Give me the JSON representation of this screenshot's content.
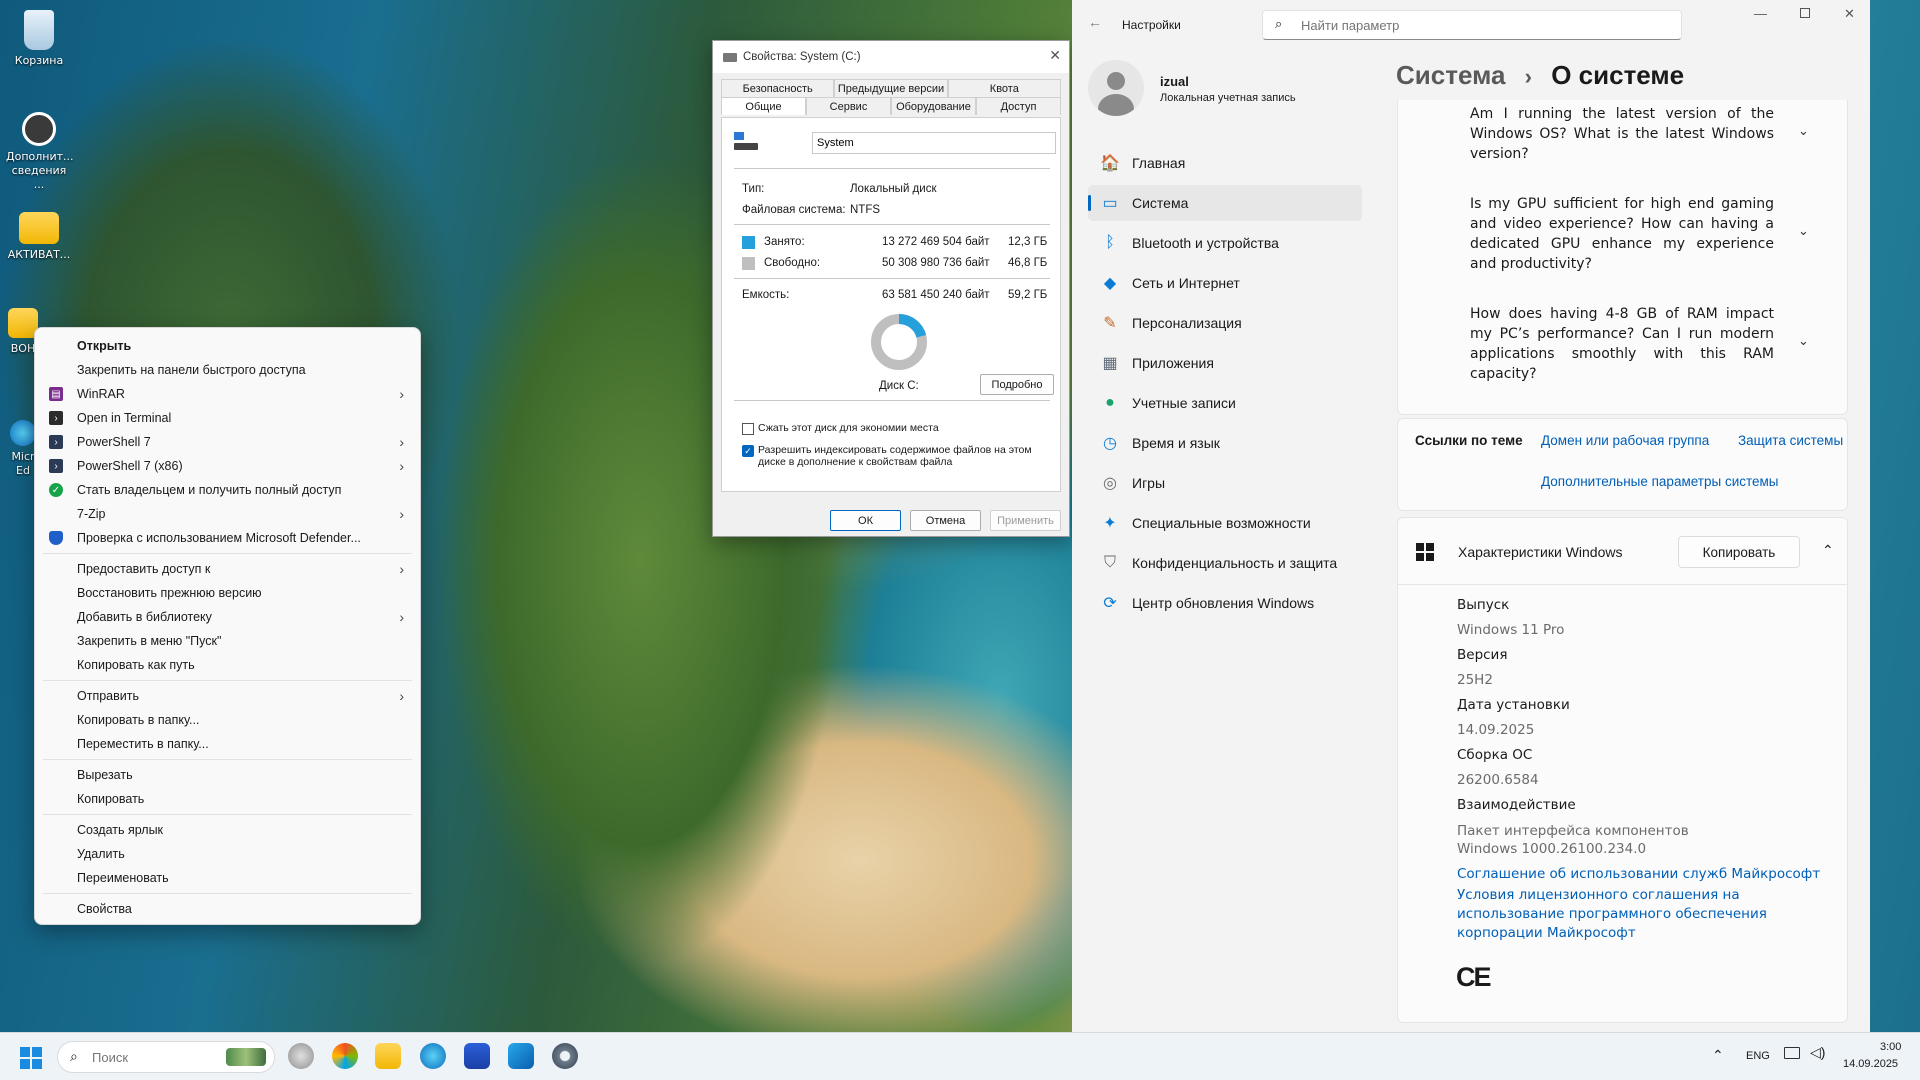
{
  "desktop": {
    "icons": [
      {
        "label": "Корзина"
      },
      {
        "label": "Дополнит... сведения ..."
      },
      {
        "label": "АКТИВАТ..."
      },
      {
        "label": "ВОН"
      },
      {
        "label": "Micr Ed"
      }
    ]
  },
  "context_menu": {
    "items": [
      {
        "label": "Открыть"
      },
      {
        "label": "Закрепить на панели быстрого доступа"
      },
      {
        "label": "WinRAR"
      },
      {
        "label": "Open in Terminal"
      },
      {
        "label": "PowerShell 7"
      },
      {
        "label": "PowerShell 7 (x86)"
      },
      {
        "label": "Стать владельцем и получить полный доступ"
      },
      {
        "label": "7-Zip"
      },
      {
        "label": "Проверка с использованием Microsoft Defender..."
      },
      {
        "label": "Предоставить доступ к"
      },
      {
        "label": "Восстановить прежнюю версию"
      },
      {
        "label": "Добавить в библиотеку"
      },
      {
        "label": "Закрепить в меню \"Пуск\""
      },
      {
        "label": "Копировать как путь"
      },
      {
        "label": "Отправить"
      },
      {
        "label": "Копировать в папку..."
      },
      {
        "label": "Переместить в папку..."
      },
      {
        "label": "Вырезать"
      },
      {
        "label": "Копировать"
      },
      {
        "label": "Создать ярлык"
      },
      {
        "label": "Удалить"
      },
      {
        "label": "Переименовать"
      },
      {
        "label": "Свойства"
      }
    ]
  },
  "properties": {
    "title": "Свойства: System (C:)",
    "tabs_row1": [
      "Безопасность",
      "Предыдущие версии",
      "Квота"
    ],
    "tabs_row2": [
      "Общие",
      "Сервис",
      "Оборудование",
      "Доступ"
    ],
    "name_value": "System",
    "type_label": "Тип:",
    "type_value": "Локальный диск",
    "fs_label": "Файловая система:",
    "fs_value": "NTFS",
    "used_label": "Занято:",
    "used_bytes": "13 272 469 504 байт",
    "used_gb": "12,3 ГБ",
    "free_label": "Свободно:",
    "free_bytes": "50 308 980 736 байт",
    "free_gb": "46,8 ГБ",
    "capacity_label": "Емкость:",
    "capacity_bytes": "63 581 450 240 байт",
    "capacity_gb": "59,2 ГБ",
    "disk_label": "Диск C:",
    "details_button": "Подробно",
    "compress_label": "Сжать этот диск для экономии места",
    "index_label": "Разрешить индексировать содержимое файлов на этом диске в дополнение к свойствам файла",
    "ok": "ОК",
    "cancel": "Отмена",
    "apply": "Применить",
    "used_fraction": 0.209,
    "colors": {
      "used": "#26a0da",
      "free": "#bfbfbf"
    }
  },
  "settings": {
    "app_title": "Настройки",
    "search_placeholder": "Найти параметр",
    "user_name": "izual",
    "user_type": "Локальная учетная запись",
    "breadcrumb_parent": "Система",
    "breadcrumb_sep": "›",
    "breadcrumb_current": "О системе",
    "nav": [
      {
        "label": "Главная",
        "icon": "🏠"
      },
      {
        "label": "Система",
        "icon": "▭"
      },
      {
        "label": "Bluetooth и устройства",
        "icon": "ᛒ"
      },
      {
        "label": "Сеть и Интернет",
        "icon": "◆"
      },
      {
        "label": "Персонализация",
        "icon": "✎"
      },
      {
        "label": "Приложения",
        "icon": "▦"
      },
      {
        "label": "Учетные записи",
        "icon": "●"
      },
      {
        "label": "Время и язык",
        "icon": "◷"
      },
      {
        "label": "Игры",
        "icon": "◎"
      },
      {
        "label": "Специальные возможности",
        "icon": "✦"
      },
      {
        "label": "Конфиденциальность и защита",
        "icon": "⛉"
      },
      {
        "label": "Центр обновления Windows",
        "icon": "⟳"
      }
    ],
    "faq": [
      {
        "text": "Am I running the latest version of the Windows OS? What is the latest Windows version?"
      },
      {
        "text": "Is my GPU sufficient for high end gaming and video experience? How can having a dedicated GPU enhance my experience and productivity?"
      },
      {
        "text": "How does having 4-8 GB of RAM impact my PC’s performance? Can I run modern applications smoothly with this RAM capacity?"
      }
    ],
    "related_label": "Ссылки по теме",
    "related_links": [
      "Домен или рабочая группа",
      "Защита системы",
      "Дополнительные параметры системы"
    ],
    "win_specs_title": "Характеристики Windows",
    "copy_button": "Копировать",
    "specs": [
      {
        "label": "Выпуск",
        "value": "Windows 11 Pro"
      },
      {
        "label": "Версия",
        "value": "25H2"
      },
      {
        "label": "Дата установки",
        "value": "14.09.2025"
      },
      {
        "label": "Сборка ОС",
        "value": "26200.6584"
      },
      {
        "label": "Взаимодействие",
        "value": "Пакет интерфейса компонентов Windows 1000.26100.234.0"
      }
    ],
    "link_services": "Соглашение об использовании служб Майкрософт",
    "link_license": "Условия лицензионного соглашения на использование программного обеспечения корпорации Майкрософт",
    "ce_mark": "CE"
  },
  "taskbar": {
    "search_placeholder": "Поиск",
    "lang": "ENG",
    "time": "3:00",
    "date": "14.09.2025"
  }
}
